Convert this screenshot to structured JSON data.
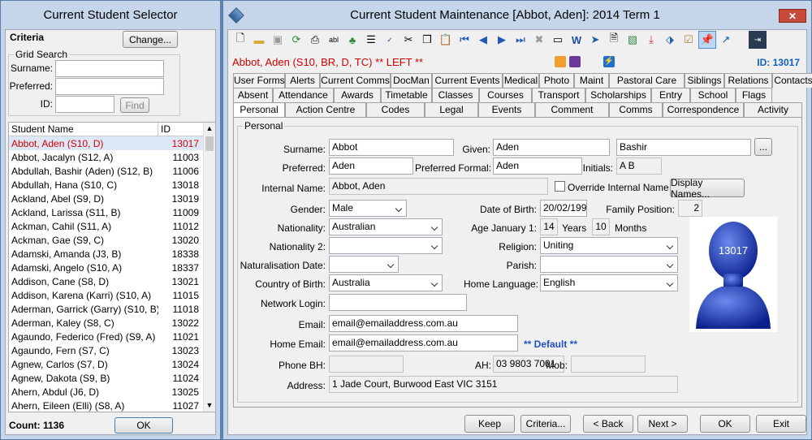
{
  "selector": {
    "title": "Current Student Selector",
    "criteria": "Criteria",
    "change": "Change...",
    "grid_search": "Grid Search",
    "surname_label": "Surname:",
    "preferred_label": "Preferred:",
    "id_label": "ID:",
    "find": "Find",
    "col_name": "Student Name",
    "col_id": "ID",
    "count_label": "Count:",
    "count_value": "1136",
    "ok": "OK",
    "students": [
      {
        "name": "Abbot, Aden (S10, D)",
        "id": "13017"
      },
      {
        "name": "Abbot, Jacalyn (S12, A)",
        "id": "11003"
      },
      {
        "name": "Abdullah, Bashir (Aden) (S12, B)",
        "id": "11006"
      },
      {
        "name": "Abdullah, Hana (S10, C)",
        "id": "13018"
      },
      {
        "name": "Ackland, Abel (S9, D)",
        "id": "13019"
      },
      {
        "name": "Ackland, Larissa (S11, B)",
        "id": "11009"
      },
      {
        "name": "Ackman, Cahil (S11, A)",
        "id": "11012"
      },
      {
        "name": "Ackman, Gae (S9, C)",
        "id": "13020"
      },
      {
        "name": "Adamski, Amanda (J3, B)",
        "id": "18338"
      },
      {
        "name": "Adamski, Angelo (S10, A)",
        "id": "18337"
      },
      {
        "name": "Addison, Cane (S8, D)",
        "id": "13021"
      },
      {
        "name": "Addison, Karena (Karri) (S10, A)",
        "id": "11015"
      },
      {
        "name": "Aderman, Garrick (Garry) (S10, B)",
        "id": "11018"
      },
      {
        "name": "Aderman, Kaley (S8, C)",
        "id": "13022"
      },
      {
        "name": "Agaundo, Federico (Fred) (S9, A)",
        "id": "11021"
      },
      {
        "name": "Agaundo, Fern (S7, C)",
        "id": "13023"
      },
      {
        "name": "Agnew, Carlos (S7, D)",
        "id": "13024"
      },
      {
        "name": "Agnew, Dakota (S9, B)",
        "id": "11024"
      },
      {
        "name": "Ahern, Abdul (J6, D)",
        "id": "13025"
      },
      {
        "name": "Ahern, Eileen (Elli) (S8, A)",
        "id": "11027"
      }
    ]
  },
  "maint": {
    "title": "Current Student Maintenance  [Abbot, Aden]:  2014 Term 1",
    "student_line": "Abbot, Aden (S10, BR, D, TC) ** LEFT **",
    "id_line": "ID: 13017",
    "tabs_row1": [
      "User Forms",
      "Alerts",
      "Current Comms",
      "DocMan",
      "Current Events",
      "Medical",
      "Photo",
      "Maint",
      "Pastoral Care",
      "Siblings",
      "Relations",
      "Contacts"
    ],
    "tabs_row2": [
      "Absent",
      "Attendance",
      "Awards",
      "Timetable",
      "Classes",
      "Courses",
      "Transport",
      "Scholarships",
      "Entry",
      "School",
      "Flags"
    ],
    "tabs_row3": [
      "Personal",
      "Action Centre",
      "Codes",
      "Legal",
      "Events",
      "Comment",
      "Comms",
      "Correspondence",
      "Activity"
    ],
    "section": "Personal",
    "fields": {
      "surname_l": "Surname:",
      "surname": "Abbot",
      "given_l": "Given:",
      "given": "Aden",
      "given2": "Bashir",
      "dots": "...",
      "preferred_l": "Preferred:",
      "preferred": "Aden",
      "pref_formal_l": "Preferred Formal:",
      "pref_formal": "Aden",
      "initials_l": "Initials:",
      "initials": "A B",
      "internal_l": "Internal Name:",
      "internal": "Abbot, Aden",
      "override": "Override Internal Name",
      "display_names": "Display Names...",
      "gender_l": "Gender:",
      "gender": "Male",
      "dob_l": "Date of Birth:",
      "dob": "20/02/1999",
      "family_l": "Family Position:",
      "family": "2",
      "nationality_l": "Nationality:",
      "nationality": "Australian",
      "age_l": "Age January 1:",
      "age_y": "14",
      "years": "Years",
      "age_m": "10",
      "months": "Months",
      "nationality2_l": "Nationality 2:",
      "nationality2": "",
      "religion_l": "Religion:",
      "religion": "Uniting",
      "natdate_l": "Naturalisation Date:",
      "natdate": "",
      "parish_l": "Parish:",
      "parish": "",
      "cob_l": "Country of Birth:",
      "cob": "Australia",
      "homelang_l": "Home Language:",
      "homelang": "English",
      "netlogin_l": "Network Login:",
      "netlogin": "",
      "email_l": "Email:",
      "email": "email@emailaddress.com.au",
      "homeemail_l": "Home Email:",
      "homeemail": "email@emailaddress.com.au",
      "default": "** Default **",
      "phonebh_l": "Phone BH:",
      "phonebh": "",
      "ah_l": "AH:",
      "ah": "03 9803 7001",
      "mob_l": "Mob:",
      "mob": "",
      "address_l": "Address:",
      "address": "1 Jade Court, Burwood East VIC 3151",
      "photo_id": "13017"
    },
    "buttons": {
      "keep": "Keep",
      "criteria": "Criteria...",
      "back": "< Back",
      "next": "Next >",
      "ok": "OK",
      "exit": "Exit"
    }
  }
}
